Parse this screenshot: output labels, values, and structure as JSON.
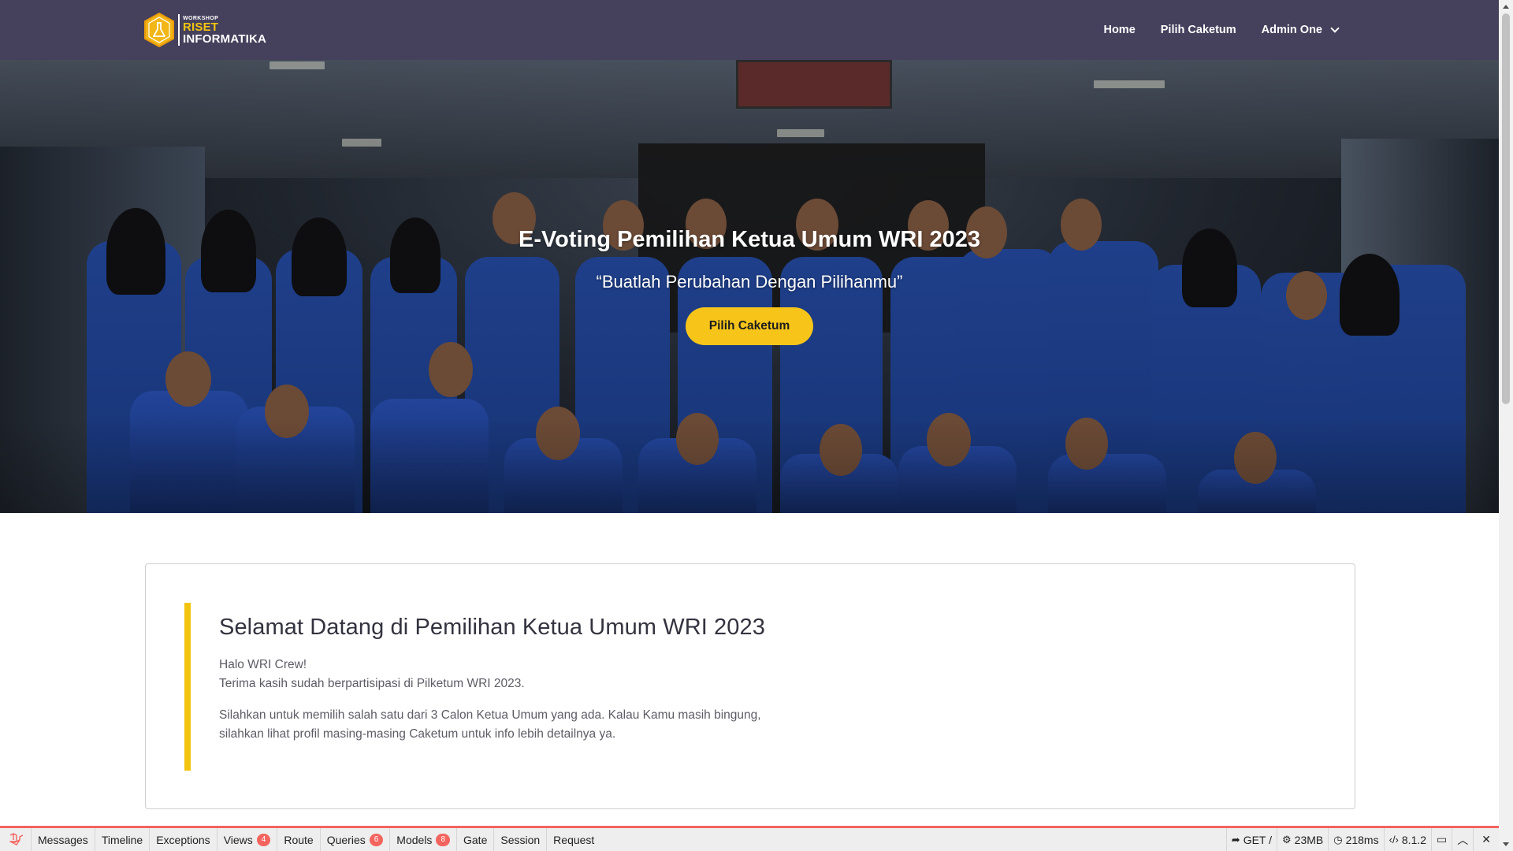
{
  "navbar": {
    "brand": {
      "small": "WORKSHOP",
      "riset": "RISET",
      "informatika": "INFORMATIKA"
    },
    "links": [
      {
        "label": "Home"
      },
      {
        "label": "Pilih Caketum"
      },
      {
        "label": "Admin One"
      }
    ]
  },
  "hero": {
    "title": "E-Voting Pemilihan Ketua Umum WRI 2023",
    "quote": "“Buatlah Perubahan Dengan Pilihanmu”",
    "button_label": "Pilih Caketum"
  },
  "welcome": {
    "title": "Selamat Datang di Pemilihan Ketua Umum WRI 2023",
    "greeting": "Halo WRI Crew!",
    "thanks": "Terima kasih sudah berpartisipasi di Pilketum WRI 2023.",
    "instruction_line1": "Silahkan untuk memilih salah satu dari 3 Calon Ketua Umum yang ada. Kalau Kamu masih bingung,",
    "instruction_line2": "silahkan lihat profil masing-masing Caketum untuk info lebih detailnya ya."
  },
  "debugbar": {
    "tabs": [
      {
        "label": "Messages"
      },
      {
        "label": "Timeline"
      },
      {
        "label": "Exceptions"
      },
      {
        "label": "Views",
        "badge": "4"
      },
      {
        "label": "Route"
      },
      {
        "label": "Queries",
        "badge": "6"
      },
      {
        "label": "Models",
        "badge": "8"
      },
      {
        "label": "Gate"
      },
      {
        "label": "Session"
      },
      {
        "label": "Request"
      }
    ],
    "request": "GET /",
    "memory": "23MB",
    "time": "218ms",
    "php_version": "8.1.2"
  },
  "colors": {
    "navbar": "#45405c",
    "accent": "#f2c40f",
    "button": "#f7c51a",
    "debug_accent": "#f4645f"
  }
}
